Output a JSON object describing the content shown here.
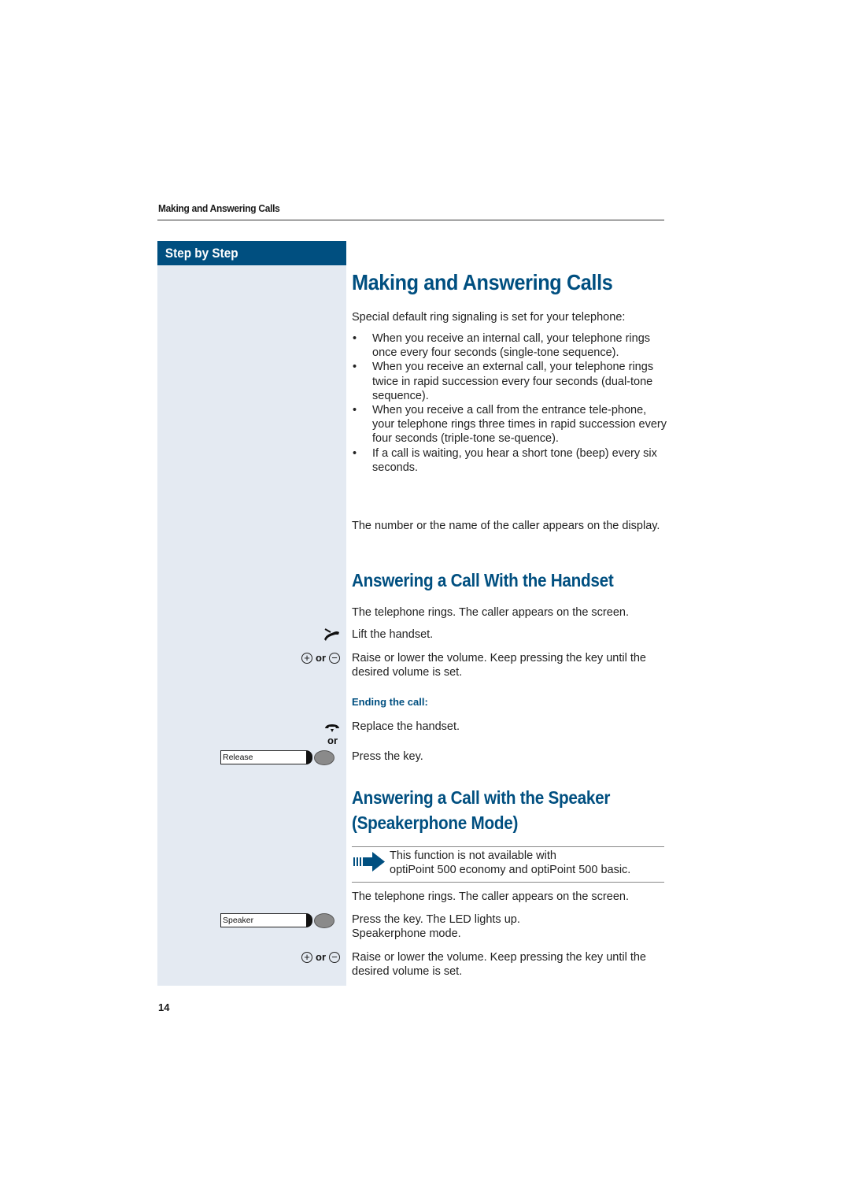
{
  "running_head": "Making and Answering Calls",
  "sidebar": {
    "header": "Step by Step"
  },
  "main": {
    "title": "Making and Answering Calls",
    "intro": "Special default ring signaling is set for your telephone:",
    "bullets": [
      "When you receive an internal call, your telephone rings once every four seconds (single-tone sequence).",
      "When you receive an external call, your telephone rings twice in rapid succession every four seconds (dual-tone sequence).",
      "When you receive a call from the entrance tele-phone, your telephone rings three times in rapid succession every four seconds (triple-tone se-quence).",
      "If a call is waiting, you hear a short tone (beep) every six seconds."
    ],
    "caller_note": "The number or the name of the caller appears on the display.",
    "handset_section": {
      "title": "Answering a Call With the Handset",
      "intro": "The telephone rings. The caller appears on the screen.",
      "steps": [
        {
          "icon": "lift-handset-icon",
          "text": "Lift the handset."
        },
        {
          "icon": "plus-minus-keys",
          "or_label": "or",
          "text": "Raise or lower the volume. Keep pressing the key until the desired volume is set."
        }
      ],
      "ending_heading": "Ending the call:",
      "ending_steps": [
        {
          "icon": "replace-handset-icon",
          "text": "Replace the handset.",
          "or_label": "or"
        },
        {
          "key_label": "Release",
          "text": "Press the key."
        }
      ]
    },
    "speaker_section": {
      "title_line1": "Answering a Call with the Speaker",
      "title_line2": "(Speakerphone Mode)",
      "note_line1": "This function is not available with",
      "note_line2": "optiPoint 500 economy and optiPoint 500 basic.",
      "intro": "The telephone rings. The caller appears on the screen.",
      "steps": [
        {
          "key_label": "Speaker",
          "text": "Press the key. The LED lights up. Speakerphone mode."
        },
        {
          "icon": "plus-minus-keys",
          "or_label": "or",
          "text": "Raise or lower the volume. Keep pressing the key until the desired volume is set."
        }
      ]
    }
  },
  "page_number": "14",
  "colors": {
    "brand_blue": "#004f80",
    "sidebar_bg": "#e4eaf2"
  }
}
